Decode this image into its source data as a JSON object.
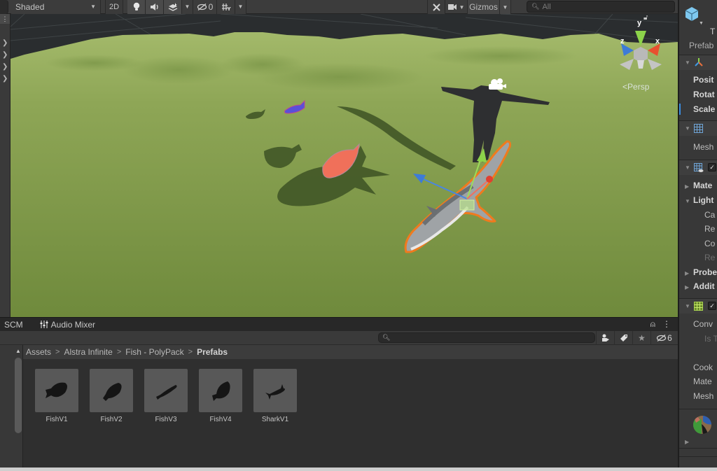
{
  "scene_toolbar": {
    "shading_mode": "Shaded",
    "mode_2d_label": "2D",
    "lighting_icon": "lightbulb-icon",
    "audio_icon": "speaker-icon",
    "effects_icon": "layers-icon",
    "hidden_objects_count": "0",
    "grid_icon": "grid-snap-icon",
    "tools_icon": "tools-icon",
    "camera_icon": "camera-icon",
    "gizmos_label": "Gizmos",
    "search_placeholder": "All"
  },
  "viewport": {
    "projection_label": "Persp",
    "axis_labels": {
      "x": "x",
      "y": "y",
      "z": "z"
    },
    "colors": {
      "terrain": "#7f9a45",
      "terrain_far": "#9fb363",
      "sky": "#2b2e30",
      "selection_outline": "#f07a1e",
      "gizmo_x": "#e8502f",
      "gizmo_y": "#8cd34a",
      "gizmo_z": "#3d7bd8",
      "red_fish": "#f0705a",
      "blue_fish": "#5a4fd8"
    }
  },
  "project_window": {
    "tabs": [
      {
        "label": "SCM"
      },
      {
        "label": "Audio Mixer",
        "icon": "mixer-sliders-icon"
      }
    ],
    "search_value": "",
    "hidden_packages_count": "6",
    "breadcrumb": [
      "Assets",
      "Alstra Infinite",
      "Fish - PolyPack",
      "Prefabs"
    ],
    "assets": [
      {
        "name": "FishV1"
      },
      {
        "name": "FishV2"
      },
      {
        "name": "FishV3"
      },
      {
        "name": "FishV4"
      },
      {
        "name": "SharkV1"
      }
    ]
  },
  "inspector": {
    "object_name_partial": "T",
    "prefab_label": "Prefab",
    "transform": {
      "position_label": "Posit",
      "rotation_label": "Rotat",
      "scale_label": "Scale"
    },
    "mesh_filter": {
      "mesh_label": "Mesh"
    },
    "mesh_renderer": {
      "enabled": true,
      "materials_label": "Mate",
      "lighting_label": "Light",
      "cast_shadows_label": "Ca",
      "receive_shadows_label": "Re",
      "contribute_gi_label": "Co",
      "receive_gi_label": "Re",
      "probes_label": "Probe",
      "additional_label": "Addit"
    },
    "mesh_collider": {
      "enabled": true,
      "convex_label": "Conv",
      "is_trigger_label": "Is T",
      "cooking_label": "Cook",
      "material_label": "Mate",
      "mesh_label": "Mesh"
    }
  }
}
